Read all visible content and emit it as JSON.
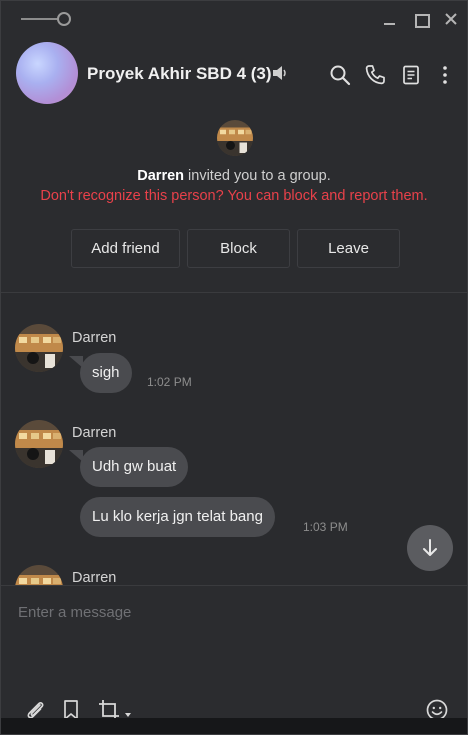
{
  "window": {
    "controls": [
      "minimize-icon",
      "maximize-icon",
      "close-icon"
    ]
  },
  "header": {
    "group_name": "Proyek Akhir SBD 4 (3)",
    "icons": [
      "mute-speaker-icon",
      "search-icon",
      "phone-icon",
      "notes-icon",
      "more-vertical-icon"
    ]
  },
  "invite": {
    "inviter": "Darren",
    "message": "invited you to a group.",
    "warning": "Don't recognize this person? You can block and report them.",
    "buttons": {
      "add_friend": "Add friend",
      "block": "Block",
      "leave": "Leave"
    }
  },
  "messages": [
    {
      "sender": "Darren",
      "bubbles": [
        {
          "text": "sigh",
          "time": "1:02 PM"
        }
      ]
    },
    {
      "sender": "Darren",
      "bubbles": [
        {
          "text": "Udh gw buat",
          "time": ""
        },
        {
          "text": "Lu klo kerja jgn telat bang",
          "time": "1:03 PM"
        }
      ]
    },
    {
      "sender": "Darren",
      "bubbles": []
    }
  ],
  "composer": {
    "placeholder": "Enter a message",
    "tools": [
      "paperclip-icon",
      "bookmark-icon",
      "crop-icon",
      "emoji-icon"
    ]
  },
  "colors": {
    "background": "#2b2c2f",
    "bubble": "#4a4b4f",
    "warning": "#e8414a"
  }
}
